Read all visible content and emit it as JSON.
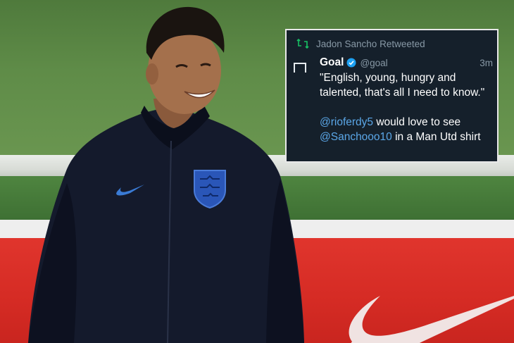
{
  "tweet": {
    "retweet_label": "Jadon Sancho Retweeted",
    "author_name": "Goal",
    "author_handle": "@goal",
    "time": "3m",
    "quote": "\"English, young, hungry and talented, that's all I need to know.\"",
    "mention_1": "@rioferdy5",
    "line2_middle": " would love to see",
    "mention_2": "@Sanchooo10",
    "line3_tail": " in a Man Utd shirt"
  },
  "colors": {
    "tweet_bg": "#15202b",
    "mention": "#5ba7e8",
    "retweet_green": "#17bf63",
    "kit_navy": "#141a2c",
    "board_red": "#d52b24"
  }
}
